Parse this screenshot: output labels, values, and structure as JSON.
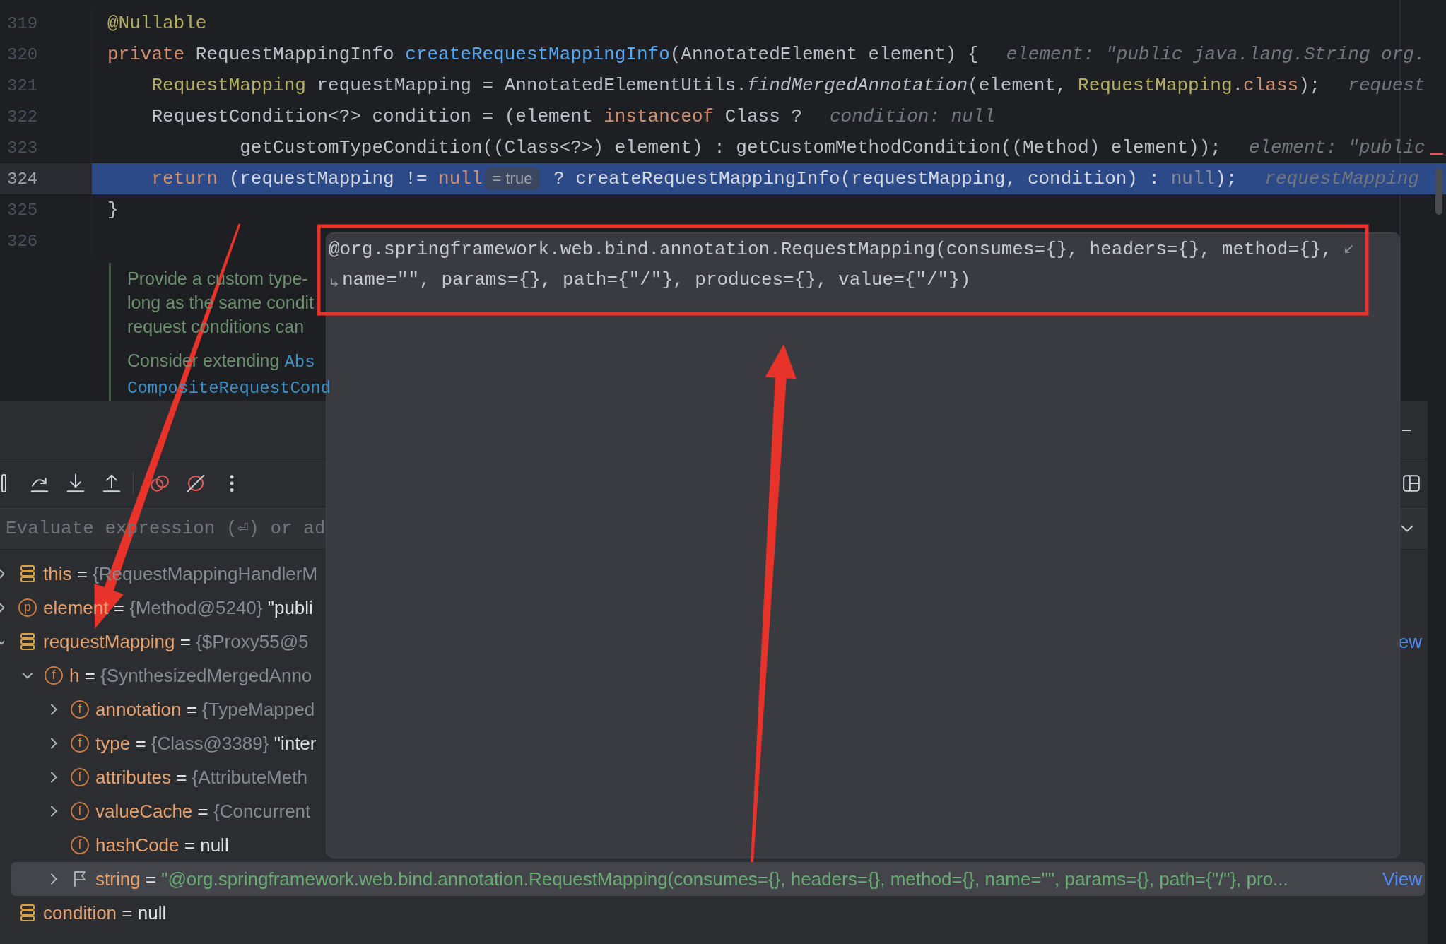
{
  "editor": {
    "lines": [
      {
        "number": "319",
        "current": false,
        "tokens": [
          {
            "kind": "annotation",
            "text": "@Nullable"
          }
        ]
      },
      {
        "number": "320",
        "current": false,
        "tokens": [
          {
            "kind": "keyword",
            "text": "private"
          },
          {
            "kind": "plain",
            "text": " RequestMappingInfo "
          },
          {
            "kind": "declaration",
            "text": "createRequestMappingInfo"
          },
          {
            "kind": "plain",
            "text": "(AnnotatedElement element) {"
          }
        ],
        "hint": "element: \"public java.lang.String org."
      },
      {
        "number": "321",
        "current": false,
        "tokens": [
          {
            "kind": "annotation",
            "text": "    RequestMapping"
          },
          {
            "kind": "plain",
            "text": " requestMapping = AnnotatedElementUtils."
          },
          {
            "kind": "static",
            "text": "findMergedAnnotation"
          },
          {
            "kind": "plain",
            "text": "(element, "
          },
          {
            "kind": "annotation",
            "text": "RequestMapping"
          },
          {
            "kind": "plain",
            "text": "."
          },
          {
            "kind": "keyword",
            "text": "class"
          },
          {
            "kind": "plain",
            "text": ");"
          }
        ],
        "hint": "request"
      },
      {
        "number": "322",
        "current": false,
        "tokens": [
          {
            "kind": "plain",
            "text": "    RequestCondition<?> condition = (element "
          },
          {
            "kind": "keyword",
            "text": "instanceof"
          },
          {
            "kind": "plain",
            "text": " Class ?"
          }
        ],
        "hint": "condition: null"
      },
      {
        "number": "323",
        "current": false,
        "tokens": [
          {
            "kind": "plain",
            "text": "            getCustomTypeCondition((Class<?>) element) : getCustomMethodCondition((Method) element));"
          }
        ],
        "hint": "element: \"public"
      },
      {
        "number": "324",
        "current": true,
        "tokens": [
          {
            "kind": "keyword",
            "text": "    return"
          },
          {
            "kind": "plain",
            "text": " (requestMapping != "
          },
          {
            "kind": "keyword",
            "text": "null"
          },
          {
            "kind": "value",
            "text": "= true"
          },
          {
            "kind": "plain",
            "text": " ? createRequestMappingInfo(requestMapping, condition) : "
          },
          {
            "kind": "unused",
            "text": "null"
          },
          {
            "kind": "plain",
            "text": ");"
          }
        ],
        "hint": "requestMapping"
      },
      {
        "number": "325",
        "current": false,
        "tokens": [
          {
            "kind": "plain",
            "text": "}"
          }
        ]
      },
      {
        "number": "326",
        "current": false
      }
    ],
    "doc_comment": {
      "paragraphs": [
        {
          "lines": [
            [
              {
                "kind": "text",
                "text": "Provide a custom type-"
              }
            ],
            [
              {
                "kind": "text",
                "text": "long as the same condit"
              }
            ],
            [
              {
                "kind": "text",
                "text": "request conditions can"
              }
            ]
          ]
        },
        {
          "lines": [
            [
              {
                "kind": "text",
                "text": "Consider extending "
              },
              {
                "kind": "link",
                "text": "Abs"
              }
            ],
            [
              {
                "kind": "link",
                "text": "CompositeRequestCond"
              }
            ]
          ]
        }
      ]
    }
  },
  "debugger": {
    "expression_field": {
      "placeholder": "Evaluate expression (⏎) or ad"
    },
    "variables": [
      {
        "name": "this",
        "kind": "local",
        "operator": "=",
        "expanded": false,
        "ref": "{RequestMappingHandlerM",
        "selected": false
      },
      {
        "name": "element",
        "kind": "member",
        "glyph": "p",
        "operator": "=",
        "expanded": false,
        "ref": "{Method@5240}",
        "value": "\"publi",
        "selected": false
      },
      {
        "name": "requestMapping",
        "kind": "local",
        "operator": "=",
        "expanded": true,
        "ref": "{$Proxy55@5",
        "link": "ew",
        "selected": false,
        "children": [
          {
            "name": "h",
            "kind": "member",
            "glyph": "f",
            "operator": "=",
            "expanded": true,
            "ref": "{SynthesizedMergedAnno",
            "selected": false,
            "children": [
              {
                "name": "annotation",
                "kind": "member",
                "glyph": "f",
                "operator": "=",
                "expanded": false,
                "ref": "{TypeMapped",
                "selected": false
              },
              {
                "name": "type",
                "kind": "member",
                "glyph": "f",
                "operator": "=",
                "expanded": false,
                "ref": "{Class@3389}",
                "value": "\"inter",
                "selected": false
              },
              {
                "name": "attributes",
                "kind": "member",
                "glyph": "f",
                "operator": "=",
                "expanded": false,
                "ref": "{AttributeMeth",
                "selected": false
              },
              {
                "name": "valueCache",
                "kind": "member",
                "glyph": "f",
                "operator": "=",
                "expanded": false,
                "ref": "{Concurrent",
                "selected": false
              },
              {
                "name": "hashCode",
                "kind": "member",
                "glyph": "f",
                "operator": "=",
                "value": "null",
                "selected": false
              },
              {
                "name": "string",
                "kind": "marked",
                "operator": "=",
                "expanded": false,
                "string": "\"@org.springframework.web.bind.annotation.RequestMapping(consumes={}, headers={}, method={}, name=\"\", params={}, path={\"/\"}, pro...",
                "link": "View",
                "selected": true
              }
            ]
          }
        ]
      },
      {
        "name": "condition",
        "kind": "local",
        "operator": "=",
        "value": "null",
        "selected": false
      }
    ]
  },
  "popup": {
    "lines": [
      "@org.springframework.web.bind.annotation.RequestMapping(consumes={}, headers={}, method={},",
      "name=\"\", params={}, path={\"/\"}, produces={}, value={\"/\"})"
    ]
  },
  "markup": [
    {
      "kind": "frame"
    },
    {
      "kind": "arrow"
    },
    {
      "kind": "arrow"
    }
  ]
}
